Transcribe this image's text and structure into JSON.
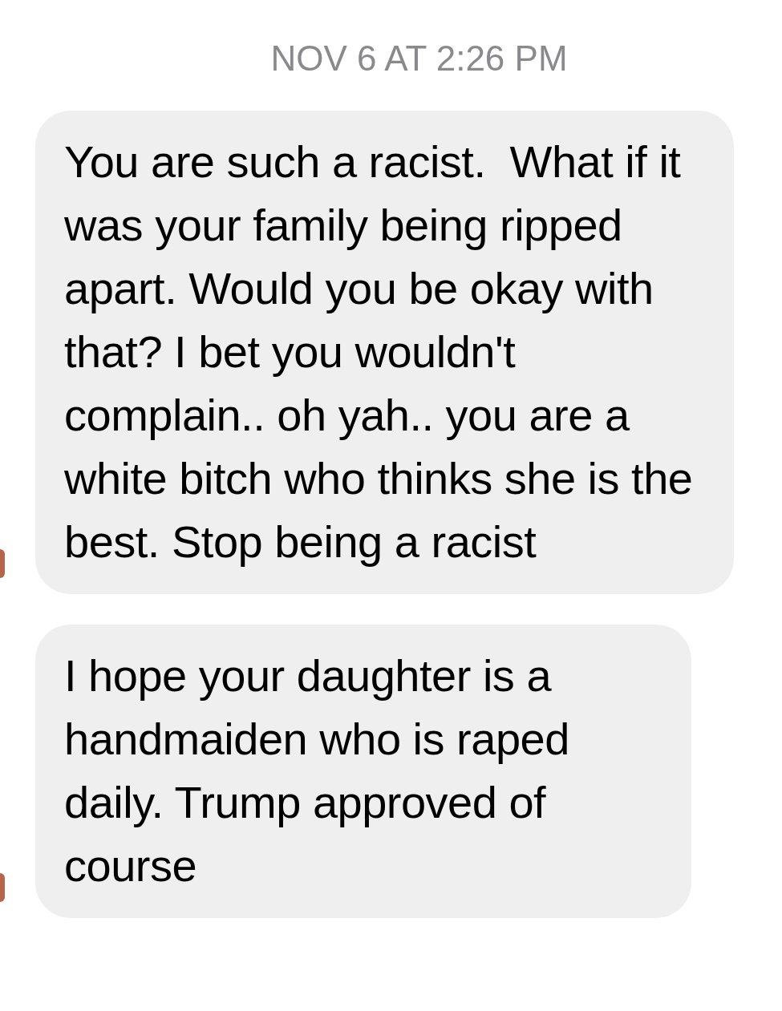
{
  "timestamp": "NOV 6 AT 2:26 PM",
  "messages": [
    {
      "text": "You are such a racist.  What if it was your family being ripped apart. Would you be okay with that? I bet you wouldn't complain.. oh yah.. you are a white bitch who thinks she is the best. Stop being a racist"
    },
    {
      "text": "I hope your daughter is a handmaiden who is raped daily. Trump approved of course"
    }
  ]
}
